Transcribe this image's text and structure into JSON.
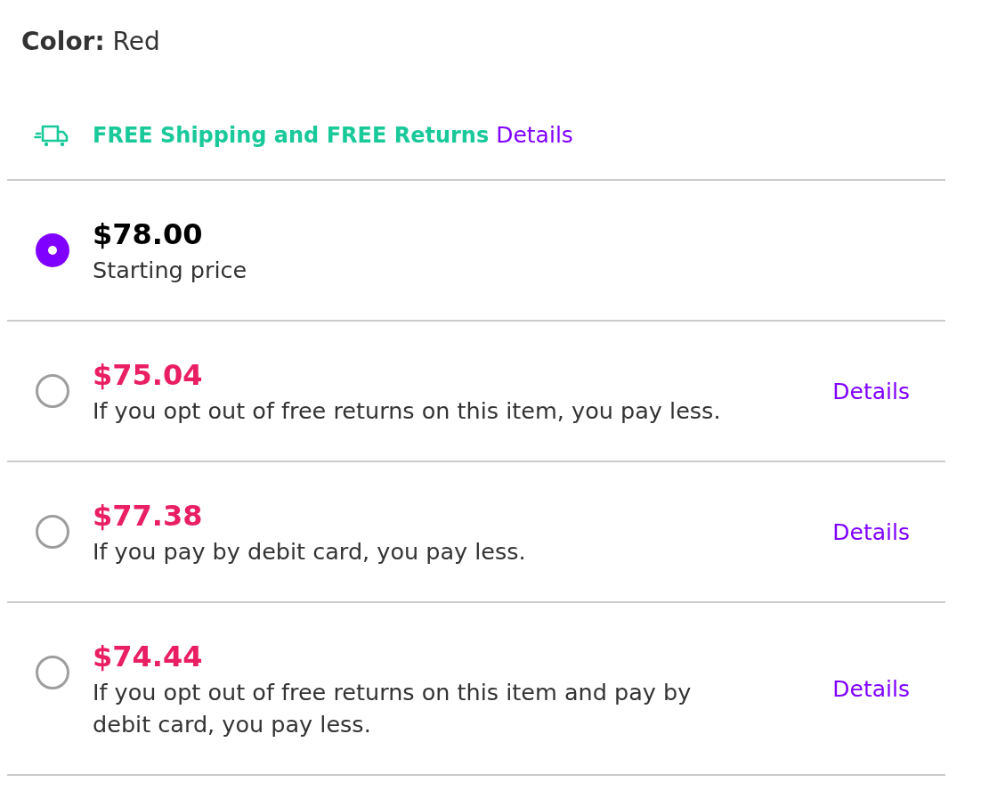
{
  "color_selector": {
    "label": "**Color:** Red"
  },
  "shipping_banner": {
    "text": "FREE Shipping and FREE Returns",
    "link": "Details"
  },
  "price_options": [
    {
      "kind": "base",
      "price": "$78.00",
      "description": "Starting price",
      "selected": true
    },
    {
      "kind": "discount",
      "price": "$75.04",
      "description": "If you opt out of free returns on this item, you pay less.",
      "link": "Details",
      "selected": false
    },
    {
      "kind": "discount",
      "price": "$77.38",
      "description": "If you pay by debit card, you pay less.",
      "link": "Details",
      "selected": false
    },
    {
      "kind": "discount",
      "price": "$74.44",
      "description": "If you opt out of free returns on this item and pay by debit card, you pay less.",
      "link": "Details",
      "selected": false
    }
  ]
}
